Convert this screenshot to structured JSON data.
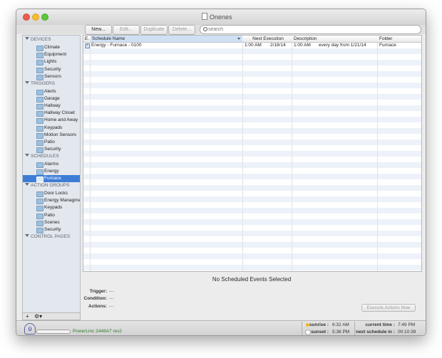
{
  "window": {
    "title": "Onenes"
  },
  "toolbar": {
    "new_label": "New...",
    "edit_label": "Edit...",
    "duplicate_label": "Duplicate",
    "delete_label": "Delete...",
    "search_placeholder": "search"
  },
  "sidebar": {
    "sections": [
      {
        "title": "DEVICES",
        "items": [
          {
            "label": "Climate"
          },
          {
            "label": "Equipment"
          },
          {
            "label": "Lights"
          },
          {
            "label": "Security"
          },
          {
            "label": "Sensors"
          }
        ]
      },
      {
        "title": "TRIGGERS",
        "items": [
          {
            "label": "Alerts"
          },
          {
            "label": "Garage"
          },
          {
            "label": "Hallway"
          },
          {
            "label": "Hallway Closet"
          },
          {
            "label": "Home and Away"
          },
          {
            "label": "Keypads"
          },
          {
            "label": "Motion Sensors"
          },
          {
            "label": "Patio"
          },
          {
            "label": "Security"
          }
        ]
      },
      {
        "title": "SCHEDULES",
        "items": [
          {
            "label": "Alarms"
          },
          {
            "label": "Energy"
          },
          {
            "label": "Furnace",
            "selected": true
          }
        ]
      },
      {
        "title": "ACTION GROUPS",
        "items": [
          {
            "label": "Door Locks"
          },
          {
            "label": "Energy Managmen"
          },
          {
            "label": "Keypads"
          },
          {
            "label": "Patio"
          },
          {
            "label": "Scenes"
          },
          {
            "label": "Security"
          }
        ]
      },
      {
        "title": "CONTROL PAGES",
        "items": []
      }
    ],
    "add_label": "+",
    "gear_label": "⚙▾"
  },
  "table": {
    "columns": [
      "E.",
      "Schedule Name",
      "Next Execution",
      "Description",
      "Folder"
    ],
    "rows": [
      {
        "enabled": "✓",
        "name": "Energy - Furnace - 0100",
        "next_time": "1:00 AM",
        "next_date": "2/18/14",
        "desc_time": "1:00 AM",
        "desc_text": "every day from 1/21/14",
        "folder": "Furnace"
      }
    ]
  },
  "detail": {
    "no_selection": "No Scheduled Events Selected",
    "trigger_label": "Trigger:",
    "trigger_value": "---",
    "condition_label": "Condition:",
    "condition_value": "---",
    "actions_label": "Actions:",
    "actions_value": "---",
    "execute_label": "Execute Actions Now"
  },
  "status": {
    "logo": "ϋ",
    "plc": "PowerLinc 2448A7 rev2",
    "sunrise_label": "sunrise :",
    "sunrise_value": "6:32 AM",
    "sunset_label": "sunset :",
    "sunset_value": "5:38 PM",
    "current_time_label": "current time :",
    "current_time_value": "7:49 PM",
    "next_schedule_label": "next schedule in :",
    "next_schedule_value": "00:10:39"
  }
}
